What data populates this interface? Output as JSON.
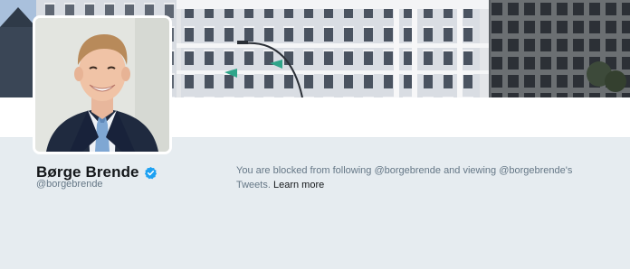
{
  "profile": {
    "display_name": "Børge Brende",
    "handle": "@borgebrende",
    "verified": true
  },
  "blocked_notice": {
    "message": "You are blocked from following @borgebrende and viewing @borgebrende's Tweets. ",
    "link_label": "Learn more"
  },
  "colors": {
    "verified_badge": "#1da1f2",
    "page_background": "#e6ecf0",
    "name_text": "#14171a",
    "secondary_text": "#657786"
  },
  "icons": {
    "verified": "verified-badge-icon"
  }
}
